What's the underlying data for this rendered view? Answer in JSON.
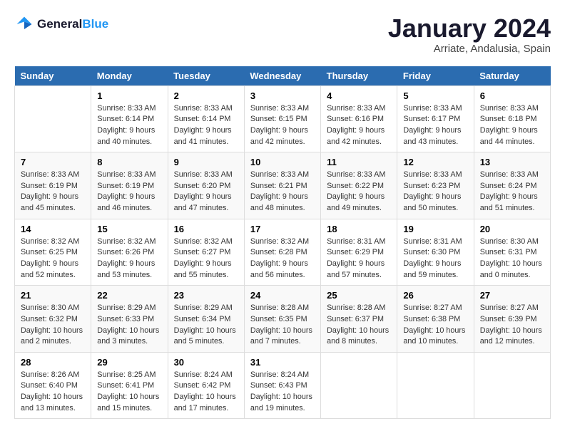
{
  "logo": {
    "line1": "General",
    "line2": "Blue"
  },
  "title": "January 2024",
  "location": "Arriate, Andalusia, Spain",
  "headers": [
    "Sunday",
    "Monday",
    "Tuesday",
    "Wednesday",
    "Thursday",
    "Friday",
    "Saturday"
  ],
  "weeks": [
    [
      {
        "day": "",
        "sunrise": "",
        "sunset": "",
        "daylight": ""
      },
      {
        "day": "1",
        "sunrise": "Sunrise: 8:33 AM",
        "sunset": "Sunset: 6:14 PM",
        "daylight": "Daylight: 9 hours and 40 minutes."
      },
      {
        "day": "2",
        "sunrise": "Sunrise: 8:33 AM",
        "sunset": "Sunset: 6:14 PM",
        "daylight": "Daylight: 9 hours and 41 minutes."
      },
      {
        "day": "3",
        "sunrise": "Sunrise: 8:33 AM",
        "sunset": "Sunset: 6:15 PM",
        "daylight": "Daylight: 9 hours and 42 minutes."
      },
      {
        "day": "4",
        "sunrise": "Sunrise: 8:33 AM",
        "sunset": "Sunset: 6:16 PM",
        "daylight": "Daylight: 9 hours and 42 minutes."
      },
      {
        "day": "5",
        "sunrise": "Sunrise: 8:33 AM",
        "sunset": "Sunset: 6:17 PM",
        "daylight": "Daylight: 9 hours and 43 minutes."
      },
      {
        "day": "6",
        "sunrise": "Sunrise: 8:33 AM",
        "sunset": "Sunset: 6:18 PM",
        "daylight": "Daylight: 9 hours and 44 minutes."
      }
    ],
    [
      {
        "day": "7",
        "sunrise": "Sunrise: 8:33 AM",
        "sunset": "Sunset: 6:19 PM",
        "daylight": "Daylight: 9 hours and 45 minutes."
      },
      {
        "day": "8",
        "sunrise": "Sunrise: 8:33 AM",
        "sunset": "Sunset: 6:19 PM",
        "daylight": "Daylight: 9 hours and 46 minutes."
      },
      {
        "day": "9",
        "sunrise": "Sunrise: 8:33 AM",
        "sunset": "Sunset: 6:20 PM",
        "daylight": "Daylight: 9 hours and 47 minutes."
      },
      {
        "day": "10",
        "sunrise": "Sunrise: 8:33 AM",
        "sunset": "Sunset: 6:21 PM",
        "daylight": "Daylight: 9 hours and 48 minutes."
      },
      {
        "day": "11",
        "sunrise": "Sunrise: 8:33 AM",
        "sunset": "Sunset: 6:22 PM",
        "daylight": "Daylight: 9 hours and 49 minutes."
      },
      {
        "day": "12",
        "sunrise": "Sunrise: 8:33 AM",
        "sunset": "Sunset: 6:23 PM",
        "daylight": "Daylight: 9 hours and 50 minutes."
      },
      {
        "day": "13",
        "sunrise": "Sunrise: 8:33 AM",
        "sunset": "Sunset: 6:24 PM",
        "daylight": "Daylight: 9 hours and 51 minutes."
      }
    ],
    [
      {
        "day": "14",
        "sunrise": "Sunrise: 8:32 AM",
        "sunset": "Sunset: 6:25 PM",
        "daylight": "Daylight: 9 hours and 52 minutes."
      },
      {
        "day": "15",
        "sunrise": "Sunrise: 8:32 AM",
        "sunset": "Sunset: 6:26 PM",
        "daylight": "Daylight: 9 hours and 53 minutes."
      },
      {
        "day": "16",
        "sunrise": "Sunrise: 8:32 AM",
        "sunset": "Sunset: 6:27 PM",
        "daylight": "Daylight: 9 hours and 55 minutes."
      },
      {
        "day": "17",
        "sunrise": "Sunrise: 8:32 AM",
        "sunset": "Sunset: 6:28 PM",
        "daylight": "Daylight: 9 hours and 56 minutes."
      },
      {
        "day": "18",
        "sunrise": "Sunrise: 8:31 AM",
        "sunset": "Sunset: 6:29 PM",
        "daylight": "Daylight: 9 hours and 57 minutes."
      },
      {
        "day": "19",
        "sunrise": "Sunrise: 8:31 AM",
        "sunset": "Sunset: 6:30 PM",
        "daylight": "Daylight: 9 hours and 59 minutes."
      },
      {
        "day": "20",
        "sunrise": "Sunrise: 8:30 AM",
        "sunset": "Sunset: 6:31 PM",
        "daylight": "Daylight: 10 hours and 0 minutes."
      }
    ],
    [
      {
        "day": "21",
        "sunrise": "Sunrise: 8:30 AM",
        "sunset": "Sunset: 6:32 PM",
        "daylight": "Daylight: 10 hours and 2 minutes."
      },
      {
        "day": "22",
        "sunrise": "Sunrise: 8:29 AM",
        "sunset": "Sunset: 6:33 PM",
        "daylight": "Daylight: 10 hours and 3 minutes."
      },
      {
        "day": "23",
        "sunrise": "Sunrise: 8:29 AM",
        "sunset": "Sunset: 6:34 PM",
        "daylight": "Daylight: 10 hours and 5 minutes."
      },
      {
        "day": "24",
        "sunrise": "Sunrise: 8:28 AM",
        "sunset": "Sunset: 6:35 PM",
        "daylight": "Daylight: 10 hours and 7 minutes."
      },
      {
        "day": "25",
        "sunrise": "Sunrise: 8:28 AM",
        "sunset": "Sunset: 6:37 PM",
        "daylight": "Daylight: 10 hours and 8 minutes."
      },
      {
        "day": "26",
        "sunrise": "Sunrise: 8:27 AM",
        "sunset": "Sunset: 6:38 PM",
        "daylight": "Daylight: 10 hours and 10 minutes."
      },
      {
        "day": "27",
        "sunrise": "Sunrise: 8:27 AM",
        "sunset": "Sunset: 6:39 PM",
        "daylight": "Daylight: 10 hours and 12 minutes."
      }
    ],
    [
      {
        "day": "28",
        "sunrise": "Sunrise: 8:26 AM",
        "sunset": "Sunset: 6:40 PM",
        "daylight": "Daylight: 10 hours and 13 minutes."
      },
      {
        "day": "29",
        "sunrise": "Sunrise: 8:25 AM",
        "sunset": "Sunset: 6:41 PM",
        "daylight": "Daylight: 10 hours and 15 minutes."
      },
      {
        "day": "30",
        "sunrise": "Sunrise: 8:24 AM",
        "sunset": "Sunset: 6:42 PM",
        "daylight": "Daylight: 10 hours and 17 minutes."
      },
      {
        "day": "31",
        "sunrise": "Sunrise: 8:24 AM",
        "sunset": "Sunset: 6:43 PM",
        "daylight": "Daylight: 10 hours and 19 minutes."
      },
      {
        "day": "",
        "sunrise": "",
        "sunset": "",
        "daylight": ""
      },
      {
        "day": "",
        "sunrise": "",
        "sunset": "",
        "daylight": ""
      },
      {
        "day": "",
        "sunrise": "",
        "sunset": "",
        "daylight": ""
      }
    ]
  ]
}
